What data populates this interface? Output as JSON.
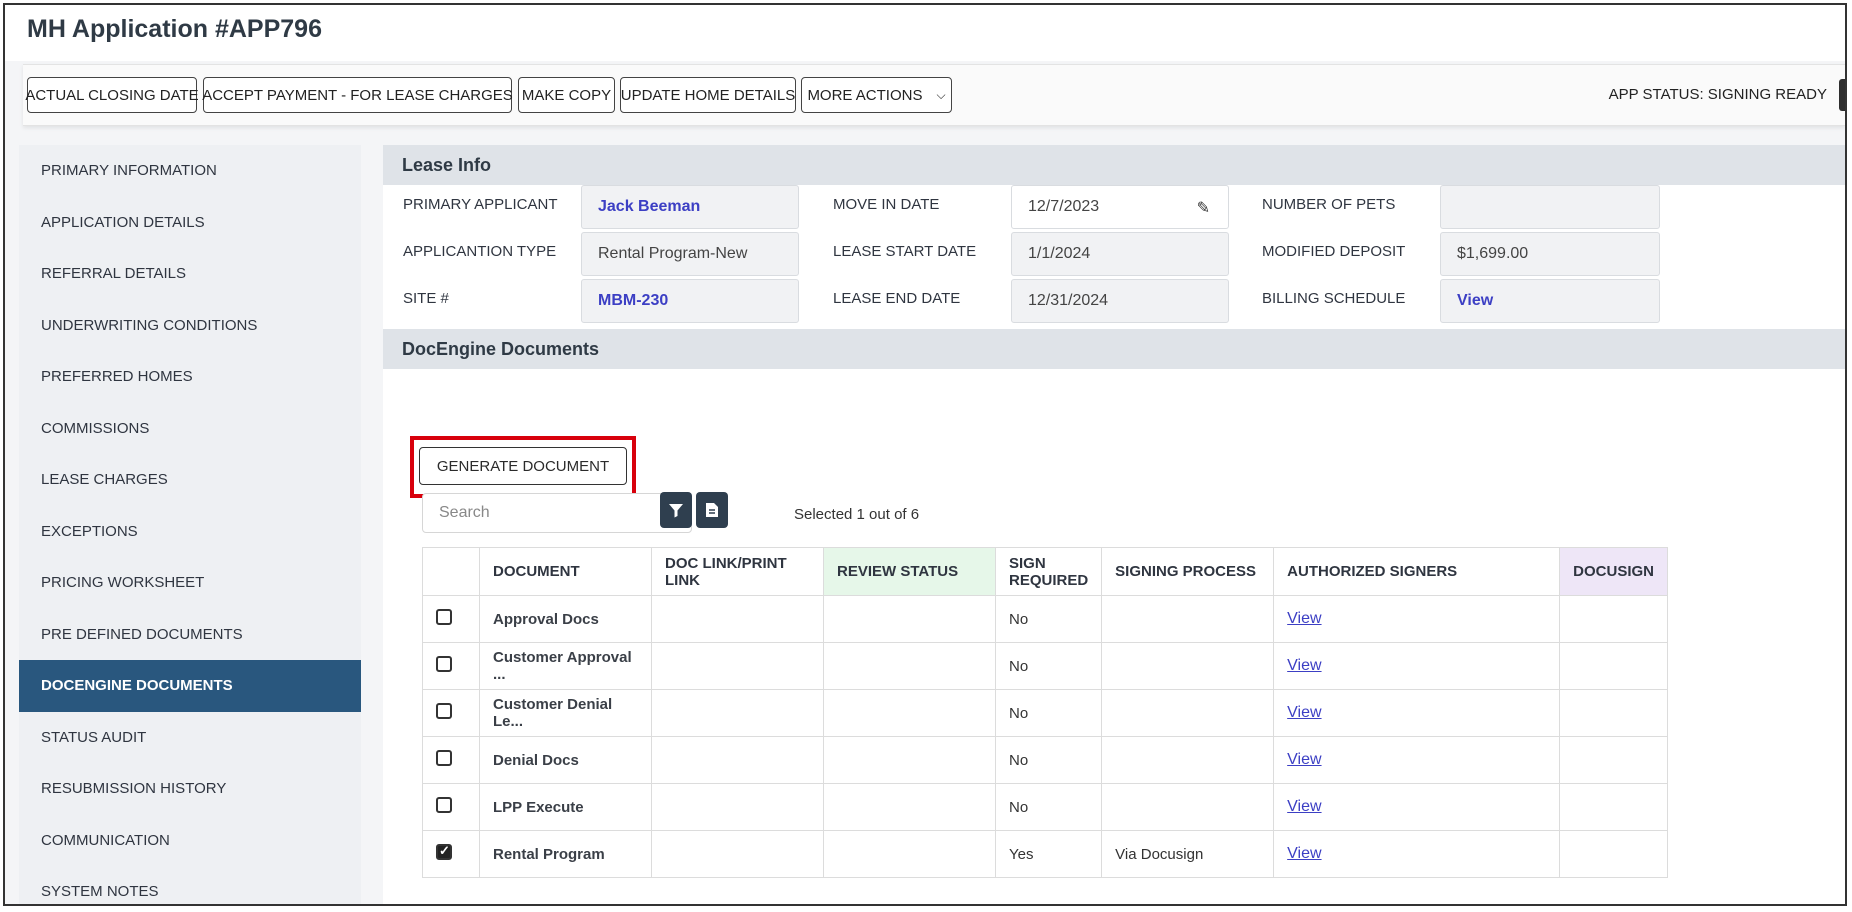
{
  "app": {
    "title": "MH Application #APP796"
  },
  "toolbar": {
    "actual_closing_date": "ACTUAL CLOSING DATE",
    "accept_payment": "ACCEPT PAYMENT - FOR LEASE CHARGES",
    "make_copy": "MAKE COPY",
    "update_home_details": "UPDATE HOME DETAILS",
    "more_actions": "MORE ACTIONS",
    "app_status": "APP STATUS: SIGNING READY"
  },
  "sidebar": {
    "items": [
      {
        "label": "PRIMARY INFORMATION",
        "active": false
      },
      {
        "label": "APPLICATION DETAILS",
        "active": false
      },
      {
        "label": "REFERRAL DETAILS",
        "active": false
      },
      {
        "label": "UNDERWRITING CONDITIONS",
        "active": false
      },
      {
        "label": "PREFERRED HOMES",
        "active": false
      },
      {
        "label": "COMMISSIONS",
        "active": false
      },
      {
        "label": "LEASE CHARGES",
        "active": false
      },
      {
        "label": "EXCEPTIONS",
        "active": false
      },
      {
        "label": "PRICING WORKSHEET",
        "active": false
      },
      {
        "label": "PRE DEFINED DOCUMENTS",
        "active": false
      },
      {
        "label": "DOCENGINE DOCUMENTS",
        "active": true
      },
      {
        "label": "STATUS AUDIT",
        "active": false
      },
      {
        "label": "RESUBMISSION HISTORY",
        "active": false
      },
      {
        "label": "COMMUNICATION",
        "active": false
      },
      {
        "label": "SYSTEM NOTES",
        "active": false
      }
    ]
  },
  "lease_info": {
    "heading": "Lease Info",
    "primary_applicant_label": "PRIMARY APPLICANT",
    "primary_applicant_value": "Jack Beeman",
    "application_type_label": "APPLICANTION TYPE",
    "application_type_value": "Rental Program-New",
    "site_label": "SITE #",
    "site_value": "MBM-230",
    "move_in_label": "MOVE IN DATE",
    "move_in_value": "12/7/2023",
    "lease_start_label": "LEASE START DATE",
    "lease_start_value": "1/1/2024",
    "lease_end_label": "LEASE END DATE",
    "lease_end_value": "12/31/2024",
    "pets_label": "NUMBER OF PETS",
    "pets_value": "",
    "deposit_label": "MODIFIED DEPOSIT",
    "deposit_value": "$1,699.00",
    "billing_label": "BILLING SCHEDULE",
    "billing_value": "View"
  },
  "docengine": {
    "heading": "DocEngine Documents",
    "generate_label": "GENERATE DOCUMENT",
    "search_placeholder": "Search",
    "selected_info": "Selected 1 out of 6",
    "columns": [
      "DOCUMENT",
      "DOC LINK/PRINT LINK",
      "REVIEW STATUS",
      "SIGN REQUIRED",
      "SIGNING PROCESS",
      "AUTHORIZED SIGNERS",
      "DOCUSIGN"
    ],
    "rows": [
      {
        "checked": false,
        "document": "Approval Docs",
        "doc_link": "",
        "review_status": "",
        "sign_required": "No",
        "signing_process": "",
        "signers": "View",
        "docusign": ""
      },
      {
        "checked": false,
        "document": "Customer Approval ...",
        "doc_link": "",
        "review_status": "",
        "sign_required": "No",
        "signing_process": "",
        "signers": "View",
        "docusign": ""
      },
      {
        "checked": false,
        "document": "Customer Denial Le...",
        "doc_link": "",
        "review_status": "",
        "sign_required": "No",
        "signing_process": "",
        "signers": "View",
        "docusign": ""
      },
      {
        "checked": false,
        "document": "Denial Docs",
        "doc_link": "",
        "review_status": "",
        "sign_required": "No",
        "signing_process": "",
        "signers": "View",
        "docusign": ""
      },
      {
        "checked": false,
        "document": "LPP Execute",
        "doc_link": "",
        "review_status": "",
        "sign_required": "No",
        "signing_process": "",
        "signers": "View",
        "docusign": ""
      },
      {
        "checked": true,
        "document": "Rental Program",
        "doc_link": "",
        "review_status": "",
        "sign_required": "Yes",
        "signing_process": "Via Docusign",
        "signers": "View",
        "docusign": ""
      }
    ]
  },
  "colors": {
    "active_nav": "#29577e",
    "link": "#3c3fc4",
    "highlight": "#d8000c",
    "review_header": "#e6f7e9",
    "docusign_header": "#eee6f7"
  },
  "icons": {
    "filter": "filter-icon",
    "export": "file-export-icon",
    "more_actions": "chevron-down-icon",
    "edit": "pencil-icon"
  }
}
